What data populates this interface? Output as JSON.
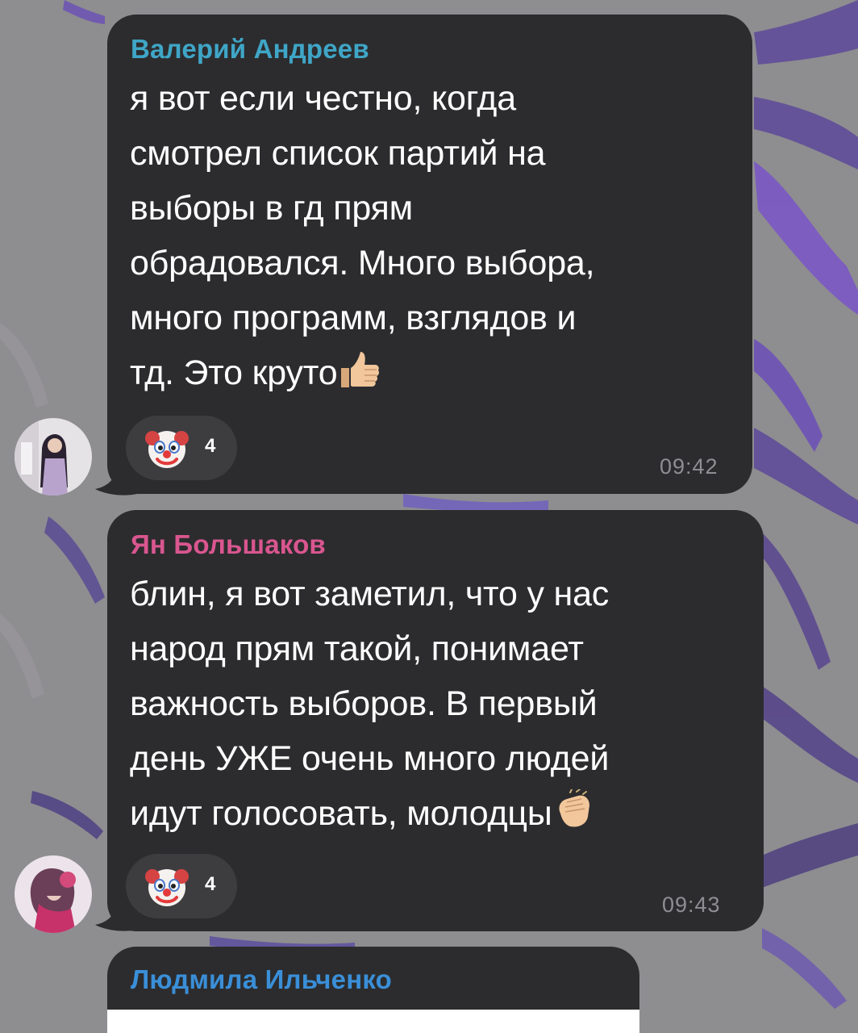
{
  "chat": {
    "messages": [
      {
        "sender": "Валерий Андреев",
        "sender_color": "#3fa6c7",
        "lines": [
          "я вот если честно, когда",
          "смотрел список партий на",
          "выборы в гд прям",
          "обрадовался. Много выбора,",
          "много программ, взглядов и",
          "тд. Это круто"
        ],
        "trailing_emoji": "thumbs-up-icon",
        "reaction": {
          "emoji": "clown-face-icon",
          "count": "4"
        },
        "time": "09:42"
      },
      {
        "sender": "Ян Большаков",
        "sender_color": "#d9568f",
        "lines": [
          "блин, я вот заметил, что у нас",
          "народ прям такой, понимает",
          "важность выборов. В первый",
          "день УЖЕ очень много людей",
          "идут голосовать, молодцы"
        ],
        "trailing_emoji": "clapping-hands-icon",
        "reaction": {
          "emoji": "clown-face-icon",
          "count": "4"
        },
        "time": "09:43"
      },
      {
        "sender": "Людмила Ильченко",
        "sender_color": "#3a8fd8"
      }
    ]
  },
  "colors": {
    "bubble": "#2c2c2e",
    "reaction_pill": "#3d3d40",
    "timestamp": "#8e8e93",
    "wallpaper": "#8d8c8f"
  }
}
